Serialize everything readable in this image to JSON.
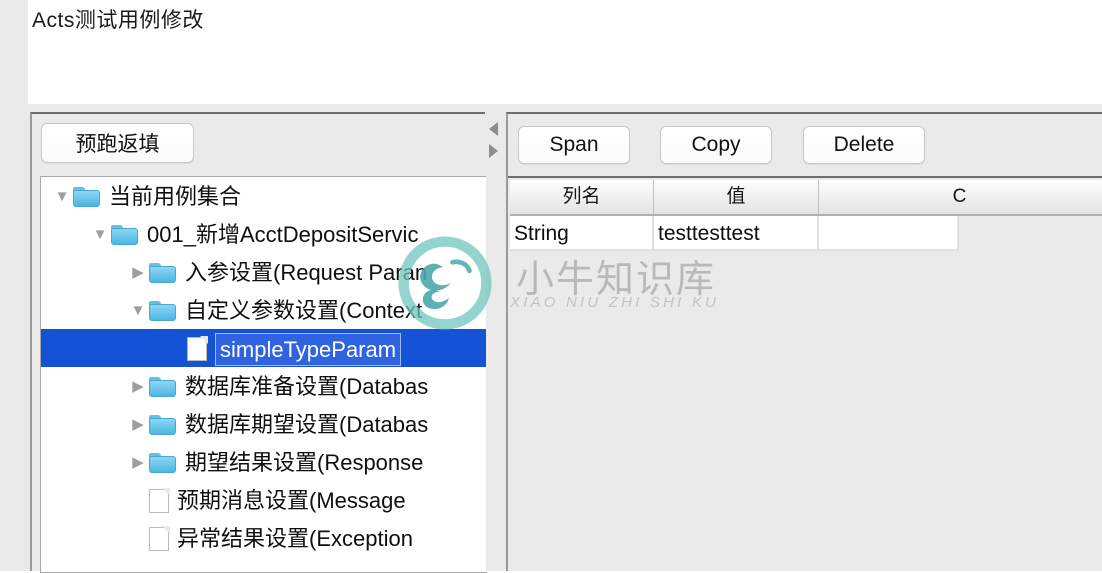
{
  "window": {
    "title": "Acts测试用例修改"
  },
  "left_panel": {
    "prerun_button": "预跑返填",
    "splitter": {
      "collapse_left_icon": "triangle-left-icon",
      "collapse_right_icon": "triangle-right-icon"
    },
    "tree": [
      {
        "label": "当前用例集合",
        "icon": "folder-icon",
        "twisty": "open",
        "depth": 0,
        "selected": false
      },
      {
        "label": "001_新增AcctDepositServic",
        "icon": "folder-icon",
        "twisty": "open",
        "depth": 1,
        "selected": false
      },
      {
        "label": "入参设置(Request Paran",
        "icon": "folder-icon",
        "twisty": "closed",
        "depth": 2,
        "selected": false
      },
      {
        "label": "自定义参数设置(Context",
        "icon": "folder-icon",
        "twisty": "open",
        "depth": 2,
        "selected": false
      },
      {
        "label": "simpleTypeParam",
        "icon": "file-icon",
        "twisty": "blank",
        "depth": 3,
        "selected": true
      },
      {
        "label": "数据库准备设置(Databas",
        "icon": "folder-icon",
        "twisty": "closed",
        "depth": 2,
        "selected": false
      },
      {
        "label": "数据库期望设置(Databas",
        "icon": "folder-icon",
        "twisty": "closed",
        "depth": 2,
        "selected": false
      },
      {
        "label": "期望结果设置(Response",
        "icon": "folder-icon",
        "twisty": "closed",
        "depth": 2,
        "selected": false
      },
      {
        "label": "预期消息设置(Message ",
        "icon": "file-icon",
        "twisty": "blank",
        "depth": 2,
        "selected": false
      },
      {
        "label": "异常结果设置(Exception",
        "icon": "file-icon",
        "twisty": "blank",
        "depth": 2,
        "selected": false
      }
    ]
  },
  "right_panel": {
    "toolbar": {
      "span_label": "Span",
      "copy_label": "Copy",
      "delete_label": "Delete"
    },
    "table": {
      "columns": [
        "列名",
        "值",
        "C"
      ],
      "rows": [
        {
          "col_name": "String",
          "value": "testtesttest",
          "c": ""
        }
      ]
    }
  },
  "watermark": {
    "cn": "小牛知识库",
    "en": "XIAO NIU ZHI SHI KU",
    "logo_icon": "ox-logo-icon",
    "color": "#b9b9b9"
  },
  "colors": {
    "selection_blue": "#1452d6",
    "panel_grey": "#eaeaea",
    "folder_blue": "#63c0e8"
  }
}
